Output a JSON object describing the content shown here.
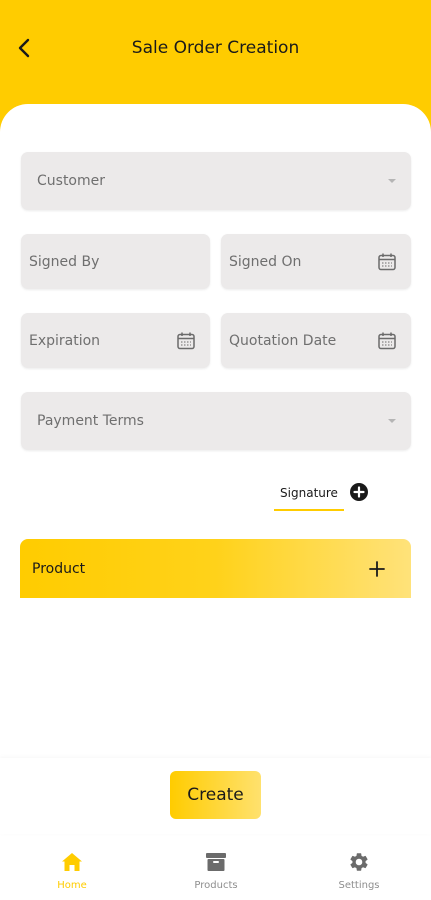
{
  "header": {
    "title": "Sale Order Creation"
  },
  "form": {
    "customer": {
      "label": "Customer"
    },
    "signed_by": {
      "label": "Signed By"
    },
    "signed_on": {
      "label": "Signed On"
    },
    "expiration": {
      "label": "Expiration"
    },
    "quotation_date": {
      "label": "Quotation Date"
    },
    "payment_terms": {
      "label": "Payment Terms"
    }
  },
  "signature": {
    "label": "Signature"
  },
  "product": {
    "label": "Product"
  },
  "actions": {
    "create_label": "Create"
  },
  "bottom_nav": {
    "items": [
      {
        "label": "Home",
        "icon": "home-icon",
        "active": true
      },
      {
        "label": "Products",
        "icon": "archive-box-icon",
        "active": false
      },
      {
        "label": "Settings",
        "icon": "gear-icon",
        "active": false
      }
    ]
  },
  "colors": {
    "accent": "#FFCC00",
    "field_bg": "#ECEAEA",
    "nav_active": "#FFCC00",
    "nav_inactive": "#8E8E8E",
    "icon_inactive": "#6B6B6B"
  }
}
